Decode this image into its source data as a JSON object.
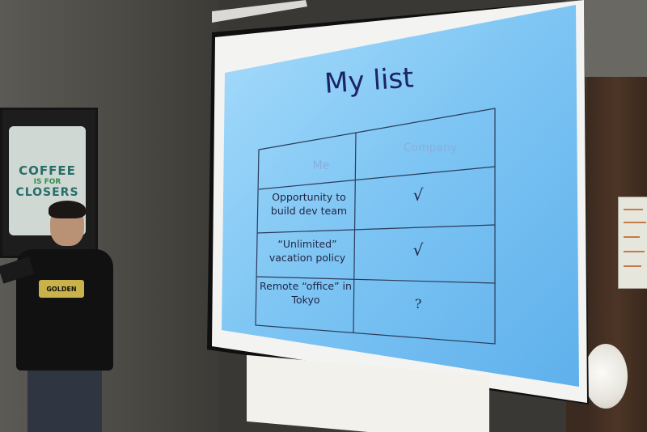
{
  "slide": {
    "title": "My list",
    "table": {
      "headers": [
        "Me",
        "Company"
      ],
      "rows": [
        {
          "item": "Opportunity to build dev team",
          "company": "√"
        },
        {
          "item": "“Unlimited” vacation policy",
          "company": "√"
        },
        {
          "item": "Remote “office” in Tokyo",
          "company": "?"
        }
      ]
    }
  },
  "poster": {
    "line1": "COFFEE",
    "line2": "IS FOR",
    "line3": "CLOSERS"
  },
  "shirt_print": "GOLDEN",
  "colors": {
    "screen": "#7cc4f3",
    "slide_text": "#1b2466",
    "banner_green": "#2c8b3a"
  }
}
